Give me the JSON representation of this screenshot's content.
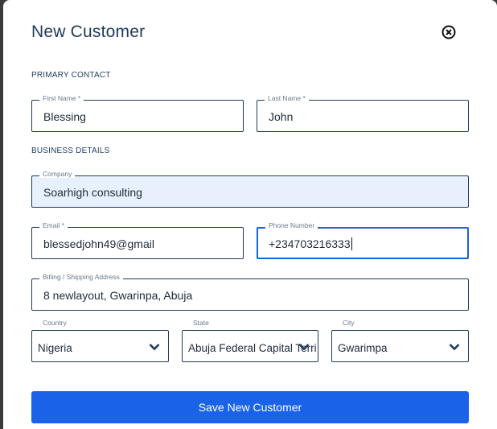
{
  "dialog": {
    "title": "New Customer",
    "close_icon": "close-circle-icon",
    "save_label": "Save New Customer"
  },
  "sections": {
    "primary": "PRIMARY CONTACT",
    "business": "BUSINESS DETAILS"
  },
  "fields": {
    "first_name": {
      "label": "First Name *",
      "value": "Blessing"
    },
    "last_name": {
      "label": "Last Name *",
      "value": "John"
    },
    "company": {
      "label": "Company",
      "value": "Soarhigh consulting"
    },
    "email": {
      "label": "Email *",
      "value": "blessedjohn49@gmail"
    },
    "phone": {
      "label": "Phone Number",
      "value": "+234703216333"
    },
    "address": {
      "label": "Billing / Shipping Address",
      "value": "8 newlayout, Gwarinpa, Abuja"
    },
    "country": {
      "label": "Country",
      "value": "Nigeria"
    },
    "state": {
      "label": "State",
      "value": "Abuja Federal Capital Terri"
    },
    "city": {
      "label": "City",
      "value": "Gwarimpa"
    }
  },
  "colors": {
    "accent": "#1a63e8",
    "text": "#1f3a5c",
    "filled_bg": "#e8f0fd"
  }
}
